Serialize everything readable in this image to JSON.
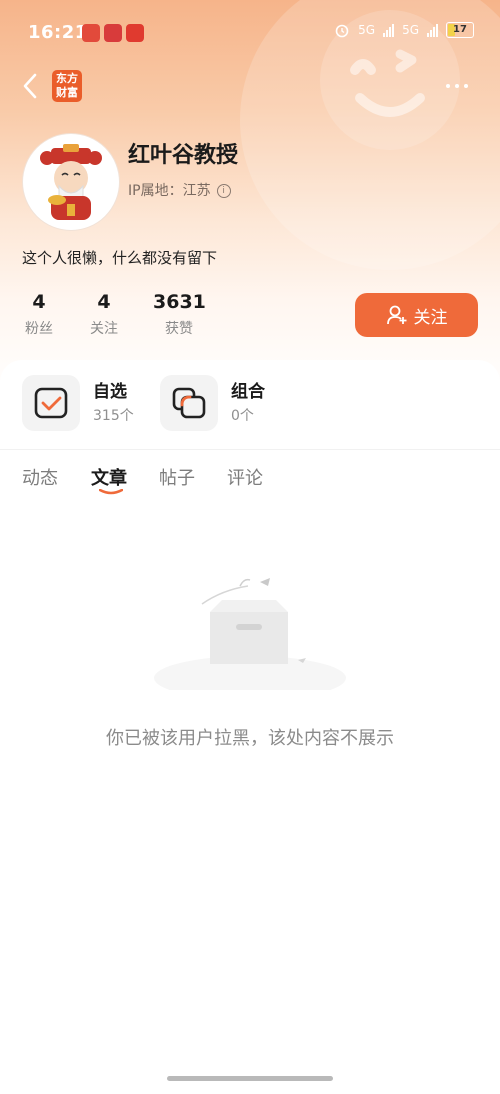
{
  "status_bar": {
    "time": "16:21",
    "network_1": "5G",
    "network_2": "5G",
    "battery": "17"
  },
  "app": {
    "logo_line1": "东方",
    "logo_line2": "财富"
  },
  "profile": {
    "name": "红叶谷教授",
    "ip_location": "IP属地：江苏",
    "bio": "这个人很懒，什么都没有留下"
  },
  "stats": [
    {
      "value": "4",
      "label": "粉丝"
    },
    {
      "value": "4",
      "label": "关注"
    },
    {
      "value": "3631",
      "label": "获赞"
    }
  ],
  "follow_button": {
    "label": "关注"
  },
  "tiles": [
    {
      "title": "自选",
      "count": "315个"
    },
    {
      "title": "组合",
      "count": "0个"
    }
  ],
  "tabs": [
    {
      "label": "动态",
      "active": false
    },
    {
      "label": "文章",
      "active": true
    },
    {
      "label": "帖子",
      "active": false
    },
    {
      "label": "评论",
      "active": false
    }
  ],
  "empty_state": {
    "message": "你已被该用户拉黑，该处内容不展示"
  },
  "colors": {
    "accent": "#ef6a3a",
    "hero_top": "#f6b48a"
  }
}
